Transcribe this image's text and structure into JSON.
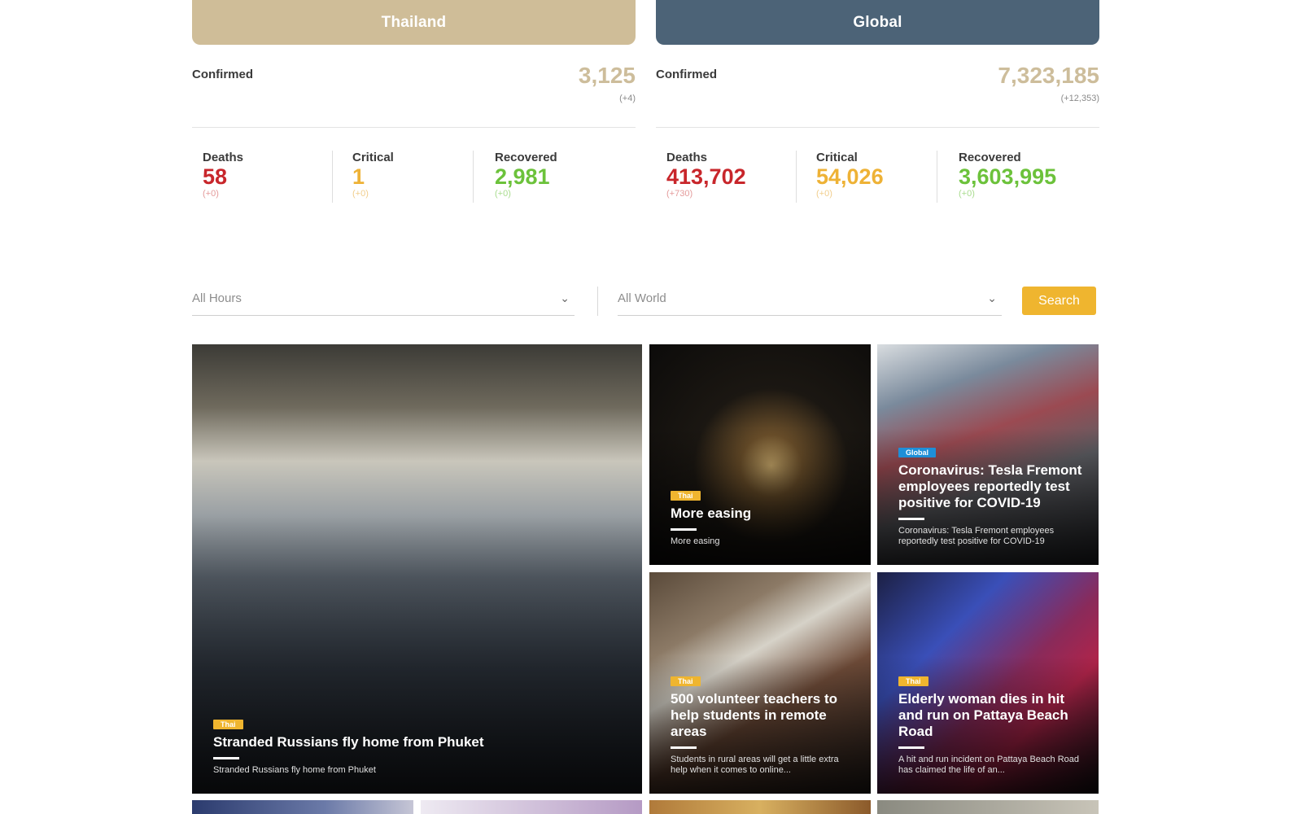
{
  "thailand": {
    "header": "Thailand",
    "confirmed_label": "Confirmed",
    "confirmed_value": "3,125",
    "confirmed_delta": "(+4)",
    "deaths": {
      "label": "Deaths",
      "value": "58",
      "delta": "(+0)"
    },
    "critical": {
      "label": "Critical",
      "value": "1",
      "delta": "(+0)"
    },
    "recovered": {
      "label": "Recovered",
      "value": "2,981",
      "delta": "(+0)"
    }
  },
  "global": {
    "header": "Global",
    "confirmed_label": "Confirmed",
    "confirmed_value": "7,323,185",
    "confirmed_delta": "(+12,353)",
    "deaths": {
      "label": "Deaths",
      "value": "413,702",
      "delta": "(+730)"
    },
    "critical": {
      "label": "Critical",
      "value": "54,026",
      "delta": "(+0)"
    },
    "recovered": {
      "label": "Recovered",
      "value": "3,603,995",
      "delta": "(+0)"
    }
  },
  "filters": {
    "hours": "All Hours",
    "region": "All World",
    "search_label": "Search"
  },
  "news": [
    {
      "tag": "Thai",
      "title": "Stranded Russians fly home from Phuket",
      "summary": "Stranded Russians fly home from Phuket"
    },
    {
      "tag": "Thai",
      "title": "More easing",
      "summary": "More easing"
    },
    {
      "tag": "Global",
      "title": "Coronavirus: Tesla Fremont employees reportedly test positive for COVID-19",
      "summary": "Coronavirus: Tesla Fremont employees reportedly test positive for COVID-19"
    },
    {
      "tag": "Thai",
      "title": "500 volunteer teachers to help students in remote areas",
      "summary": "Students in rural areas will get a little extra help when it comes to online..."
    },
    {
      "tag": "Thai",
      "title": "Elderly woman dies in hit and run on Pattaya Beach Road",
      "summary": "A hit and run incident on Pattaya Beach Road has claimed the life of an..."
    }
  ],
  "colors": {
    "thailand_header": "#cfbd98",
    "global_header": "#4c6377",
    "deaths": "#c8262b",
    "critical": "#eeb236",
    "recovered": "#6cc23b",
    "search_button": "#efb52f",
    "tag_thai": "#efb52f",
    "tag_global": "#1e8fd8"
  },
  "icons": {
    "dropdown": "chevron-down-icon"
  }
}
